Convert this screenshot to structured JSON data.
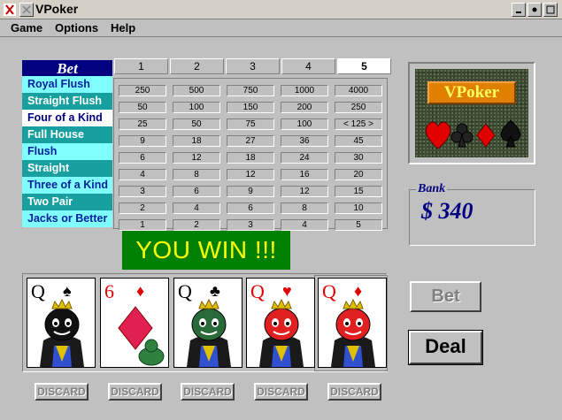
{
  "window": {
    "title": "VPoker"
  },
  "menu": [
    "Game",
    "Options",
    "Help"
  ],
  "paytable": {
    "header": "Bet",
    "columns": [
      "1",
      "2",
      "3",
      "4",
      "5"
    ],
    "active_column": 4,
    "hands": [
      "Royal Flush",
      "Straight Flush",
      "Four of a Kind",
      "Full House",
      "Flush",
      "Straight",
      "Three of a Kind",
      "Two Pair",
      "Jacks or Better"
    ],
    "rows": [
      [
        "250",
        "500",
        "750",
        "1000",
        "4000"
      ],
      [
        "50",
        "100",
        "150",
        "200",
        "250"
      ],
      [
        "25",
        "50",
        "75",
        "100",
        "< 125 >"
      ],
      [
        "9",
        "18",
        "27",
        "36",
        "45"
      ],
      [
        "6",
        "12",
        "18",
        "24",
        "30"
      ],
      [
        "4",
        "8",
        "12",
        "16",
        "20"
      ],
      [
        "3",
        "6",
        "9",
        "12",
        "15"
      ],
      [
        "2",
        "4",
        "6",
        "8",
        "10"
      ],
      [
        "1",
        "2",
        "3",
        "4",
        "5"
      ]
    ]
  },
  "banner": "YOU WIN !!!",
  "logo": "VPoker",
  "bank": {
    "label": "Bank",
    "value": "$ 340"
  },
  "buttons": {
    "bet": "Bet",
    "deal": "Deal",
    "discard": "DISCARD"
  },
  "cards": [
    {
      "rank": "Q",
      "suit": "♠",
      "color": "#000000",
      "icon": "spade-icon"
    },
    {
      "rank": "6",
      "suit": "♦",
      "color": "#e00000",
      "icon": "diamond-icon"
    },
    {
      "rank": "Q",
      "suit": "♣",
      "color": "#000000",
      "icon": "club-icon"
    },
    {
      "rank": "Q",
      "suit": "♥",
      "color": "#e00000",
      "icon": "heart-icon"
    },
    {
      "rank": "Q",
      "suit": "♦",
      "color": "#e00000",
      "icon": "diamond-icon"
    }
  ],
  "colors": {
    "win_bg": "#008000",
    "win_text": "#ffff00",
    "bank_text": "#000080",
    "bet_header": "#000080"
  }
}
